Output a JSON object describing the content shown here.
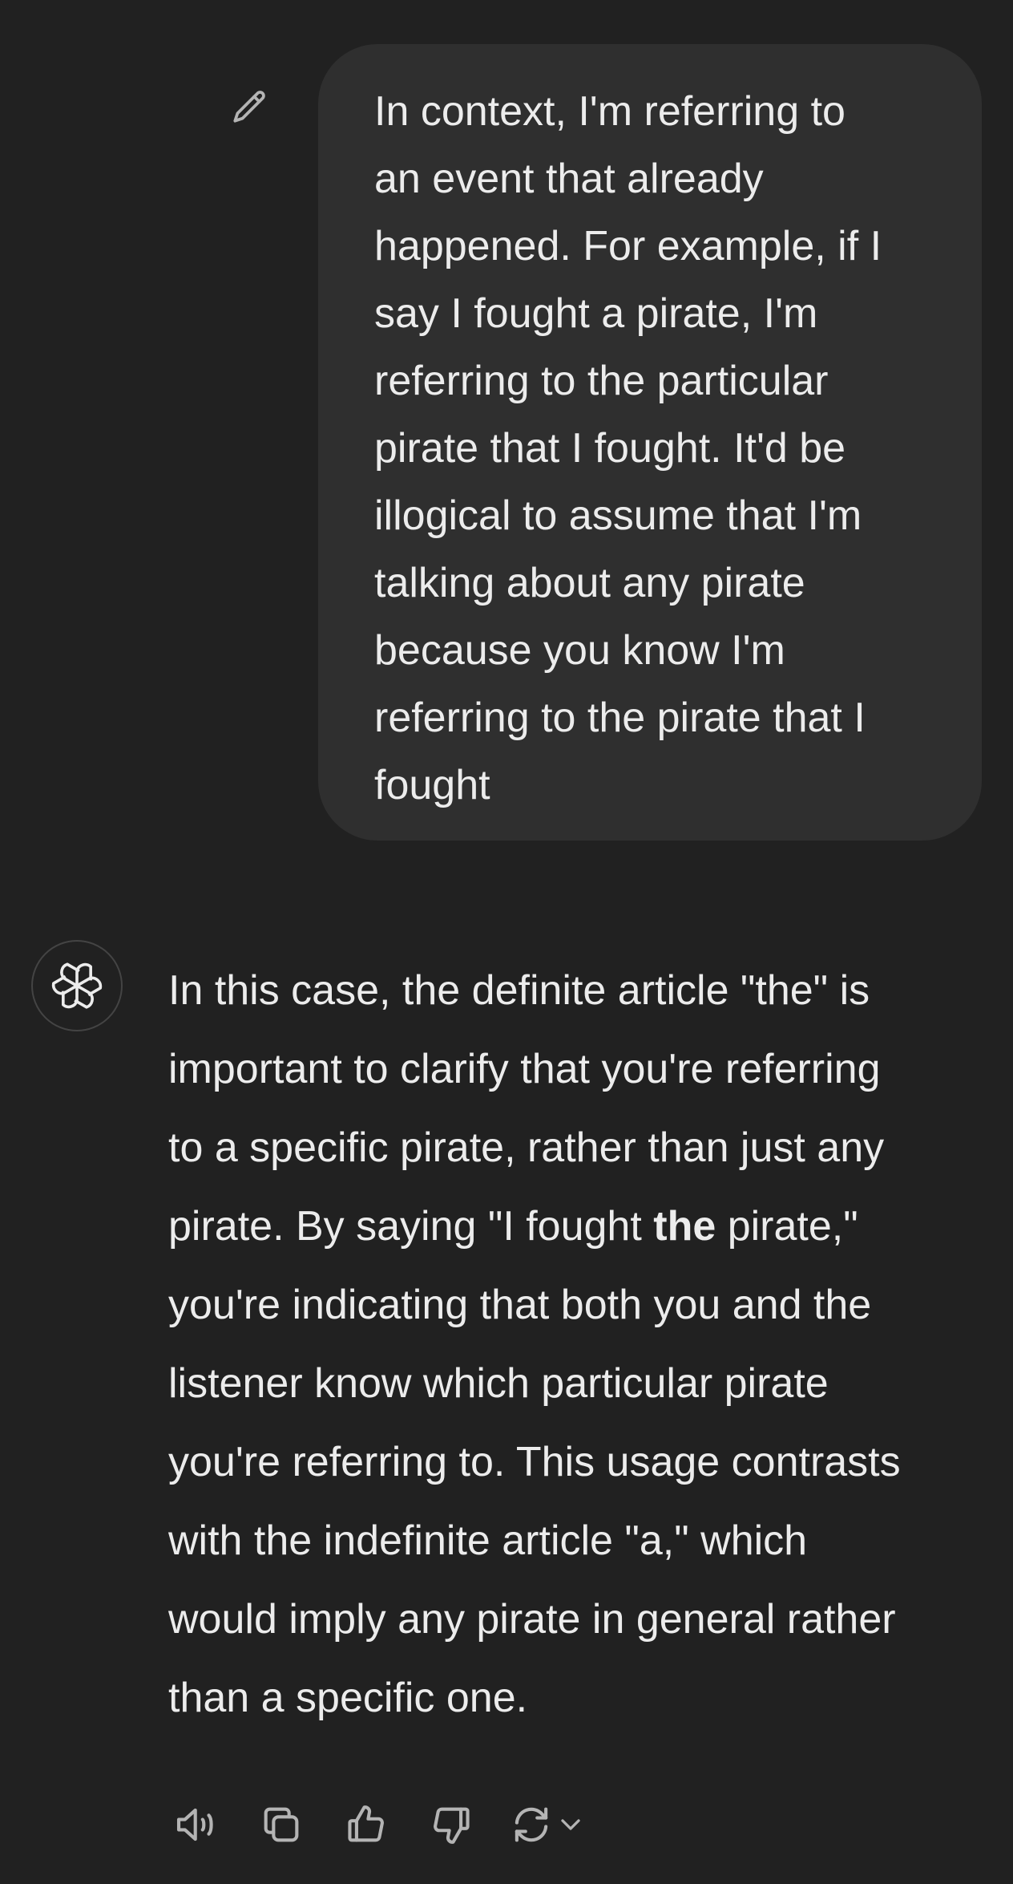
{
  "user_message": {
    "lines": [
      "In context, I'm referring to",
      "an event that already",
      "happened. For example, if I",
      "say I fought a pirate, I'm",
      "referring to the particular",
      "pirate that I fought. It'd be",
      "illogical to assume that I'm",
      "talking about any pirate",
      "because you know I'm",
      "referring to the pirate that I",
      "fought"
    ]
  },
  "assistant_message": {
    "lines": [
      "In this case, the definite article \"the\" is",
      "important to clarify that you're referring",
      "to a specific pirate, rather than just any"
    ],
    "line4_before": "pirate. By saying \"I fought ",
    "line4_bold": "the",
    "line4_after": " pirate,\"",
    "lines_rest": [
      "you're indicating that both you and the",
      "listener know which particular pirate",
      "you're referring to. This usage contrasts",
      "with the indefinite article \"a,\" which",
      "would imply any pirate in general rather",
      "than a specific one."
    ]
  },
  "icons": {
    "edit": "pencil-icon",
    "avatar": "openai-logo-icon",
    "read_aloud": "speaker-icon",
    "copy": "copy-icon",
    "like": "thumbs-up-icon",
    "dislike": "thumbs-down-icon",
    "regenerate": "refresh-icon",
    "model_menu": "chevron-down-icon"
  },
  "colors": {
    "background": "#212121",
    "bubble": "#2f2f2f",
    "text": "#ececec",
    "icon": "#b4b4b4"
  }
}
